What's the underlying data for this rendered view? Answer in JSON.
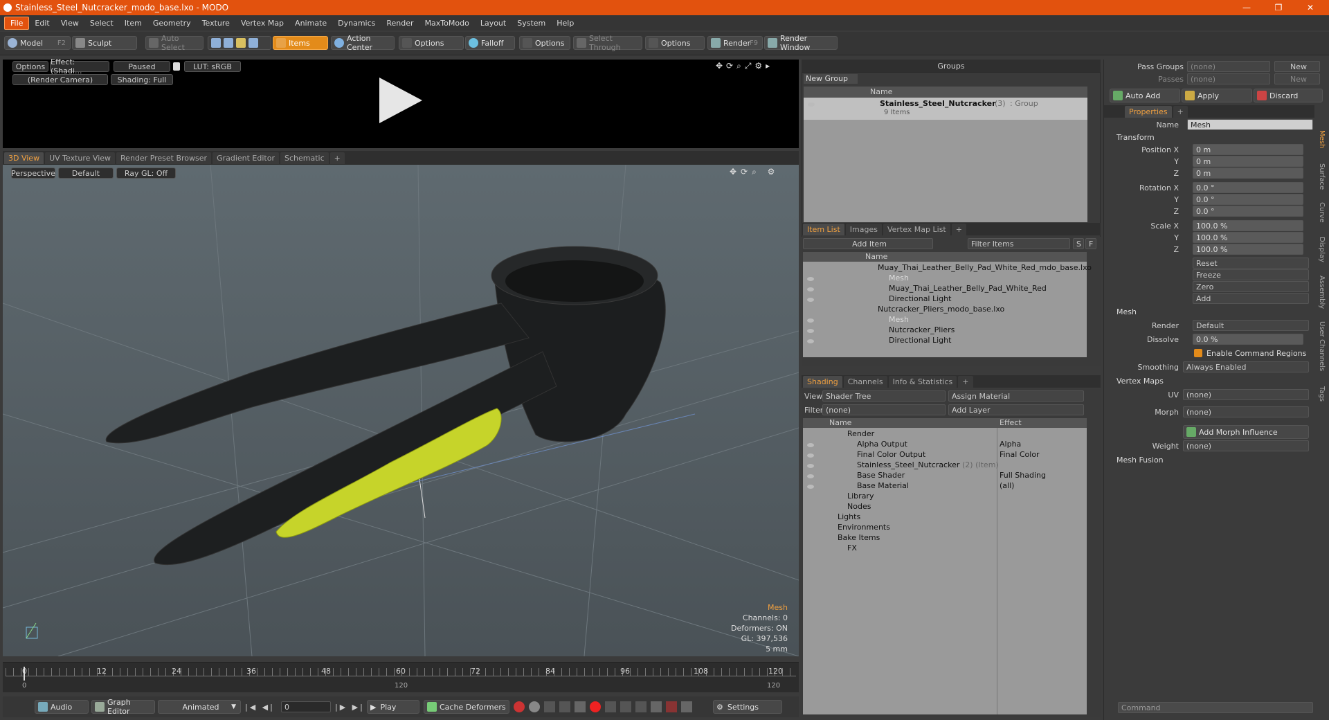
{
  "window": {
    "title": "Stainless_Steel_Nutcracker_modo_base.lxo - MODO",
    "minimize": "—",
    "maximize": "❐",
    "close": "✕"
  },
  "menu": [
    "File",
    "Edit",
    "View",
    "Select",
    "Item",
    "Geometry",
    "Texture",
    "Vertex Map",
    "Animate",
    "Dynamics",
    "Render",
    "MaxToModo",
    "Layout",
    "System",
    "Help"
  ],
  "toolbar": {
    "model": "Model",
    "model_key": "F2",
    "sculpt": "Sculpt",
    "auto_select": "Auto Select",
    "items": "Items",
    "action_center": "Action Center",
    "options": "Options",
    "falloff": "Falloff",
    "select_through": "Select Through",
    "render": "Render",
    "render_key": "F9",
    "render_window": "Render Window"
  },
  "preview": {
    "options": "Options",
    "effect": "Effect: (Shadi...",
    "paused": "Paused",
    "lut": "LUT: sRGB",
    "camera": "(Render Camera)",
    "shading": "Shading: Full"
  },
  "viewtabs": [
    "3D View",
    "UV Texture View",
    "Render Preset Browser",
    "Gradient Editor",
    "Schematic",
    "+"
  ],
  "viewport": {
    "perspective": "Perspective",
    "default": "Default",
    "raygl": "Ray GL: Off",
    "info": {
      "title": "Mesh",
      "channels": "Channels: 0",
      "deformers": "Deformers: ON",
      "gl": "GL: 397,536",
      "unit": "5 mm"
    }
  },
  "timeline": {
    "ticks": [
      "0",
      "12",
      "24",
      "36",
      "48",
      "60",
      "72",
      "84",
      "96",
      "108",
      "120"
    ],
    "range_start": "0",
    "range_mid": "120",
    "range_end": "120"
  },
  "transport": {
    "audio": "Audio",
    "graph_editor": "Graph Editor",
    "animated": "Animated",
    "frame": "0",
    "play": "Play",
    "cache": "Cache Deformers",
    "settings": "Settings"
  },
  "groups": {
    "title": "Groups",
    "new_group": "New Group",
    "col_name": "Name",
    "item_name": "Stainless_Steel_Nutcracker",
    "item_count": "(3)",
    "item_type": ": Group",
    "item_sub": "9 Items"
  },
  "itemlist": {
    "tabs": [
      "Item List",
      "Images",
      "Vertex Map List",
      "+"
    ],
    "add_item": "Add Item",
    "filter": "Filter Items",
    "s": "S",
    "f": "F",
    "col_name": "Name",
    "rows": [
      {
        "label": "Muay_Thai_Leather_Belly_Pad_White_Red_mdo_base.lxo",
        "indent": 0,
        "arrow": "▼",
        "dim": false
      },
      {
        "label": "Mesh",
        "indent": 2,
        "arrow": "",
        "dim": true
      },
      {
        "label": "Muay_Thai_Leather_Belly_Pad_White_Red",
        "indent": 1,
        "arrow": "▶",
        "dim": false,
        "suffix": "(2)"
      },
      {
        "label": "Directional Light",
        "indent": 1,
        "arrow": "",
        "dim": false
      },
      {
        "label": "Nutcracker_Pliers_modo_base.lxo",
        "indent": 0,
        "arrow": "▼",
        "dim": false
      },
      {
        "label": "Mesh",
        "indent": 2,
        "arrow": "",
        "dim": true
      },
      {
        "label": "Nutcracker_Pliers",
        "indent": 1,
        "arrow": "▶",
        "dim": false,
        "suffix": "(2)"
      },
      {
        "label": "Directional Light",
        "indent": 1,
        "arrow": "",
        "dim": false
      }
    ]
  },
  "shading": {
    "tabs": [
      "Shading",
      "Channels",
      "Info & Statistics",
      "+"
    ],
    "view_label": "View",
    "view_value": "Shader Tree",
    "assign": "Assign Material",
    "filter_label": "Filter",
    "filter_value": "(none)",
    "add_layer": "Add Layer",
    "col_name": "Name",
    "col_effect": "Effect",
    "rows": [
      {
        "label": "Render",
        "effect": "",
        "indent": 0,
        "arrow": "▼"
      },
      {
        "label": "Alpha Output",
        "effect": "Alpha",
        "indent": 1,
        "arrow": ""
      },
      {
        "label": "Final Color Output",
        "effect": "Final Color",
        "indent": 1,
        "arrow": ""
      },
      {
        "label": "Stainless_Steel_Nutcracker",
        "effect": "",
        "indent": 1,
        "arrow": "▶",
        "suffix": "(2) (Item)"
      },
      {
        "label": "Base Shader",
        "effect": "Full Shading",
        "indent": 1,
        "arrow": ""
      },
      {
        "label": "Base Material",
        "effect": "(all)",
        "indent": 1,
        "arrow": ""
      },
      {
        "label": "Library",
        "effect": "",
        "indent": 0,
        "arrow": ""
      },
      {
        "label": "Nodes",
        "effect": "",
        "indent": 0,
        "arrow": ""
      },
      {
        "label": "Lights",
        "effect": "",
        "indent": 0,
        "arrow": "▶"
      },
      {
        "label": "Environments",
        "effect": "",
        "indent": 0,
        "arrow": "▶"
      },
      {
        "label": "Bake Items",
        "effect": "",
        "indent": 0,
        "arrow": ""
      },
      {
        "label": "FX",
        "effect": "",
        "indent": 0,
        "arrow": ""
      }
    ]
  },
  "properties": {
    "pass_groups": "Pass Groups",
    "passes": "Passes",
    "none": "(none)",
    "new": "New",
    "auto_add": "Auto Add",
    "apply": "Apply",
    "discard": "Discard",
    "tab": "Properties",
    "plus": "+",
    "name_label": "Name",
    "name_value": "Mesh",
    "transform": "Transform",
    "position_x": "Position X",
    "y": "Y",
    "z": "Z",
    "pos": [
      "0 m",
      "0 m",
      "0 m"
    ],
    "rotation_x": "Rotation X",
    "rot": [
      "0.0 °",
      "0.0 °",
      "0.0 °"
    ],
    "scale_x": "Scale X",
    "scale": [
      "100.0 %",
      "100.0 %",
      "100.0 %"
    ],
    "reset": "Reset",
    "freeze": "Freeze",
    "zero": "Zero",
    "add": "Add",
    "mesh": "Mesh",
    "render_label": "Render",
    "render_value": "Default",
    "dissolve_label": "Dissolve",
    "dissolve_value": "0.0 %",
    "enable_cmd": "Enable Command Regions",
    "smoothing_label": "Smoothing",
    "smoothing_value": "Always Enabled",
    "vertex_maps": "Vertex Maps",
    "uv_label": "UV",
    "uv_value": "(none)",
    "morph_label": "Morph",
    "morph_value": "(none)",
    "add_morph": "Add Morph Influence",
    "weight_label": "Weight",
    "weight_value": "(none)",
    "mesh_fusion": "Mesh Fusion",
    "side_tabs": [
      "Mesh",
      "Surface",
      "Curve",
      "Display",
      "Assembly",
      "User Channels",
      "Tags"
    ],
    "command": "Command"
  }
}
